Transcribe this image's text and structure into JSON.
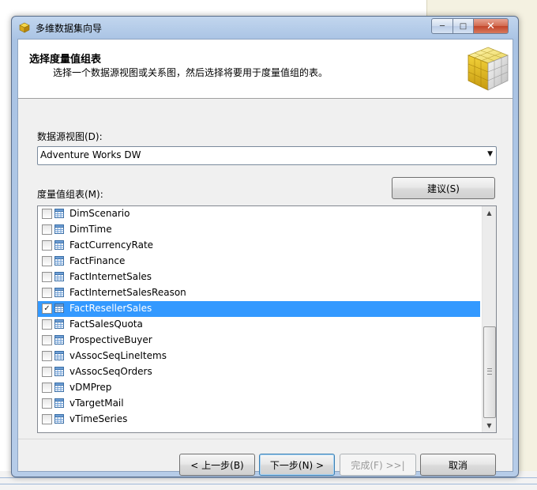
{
  "window": {
    "title": "多维数据集向导",
    "controls": {
      "minimize_icon": "minimize-icon",
      "maximize_icon": "maximize-icon",
      "close_icon": "close-icon"
    }
  },
  "header": {
    "title": "选择度量值组表",
    "subtitle": "选择一个数据源视图或关系图，然后选择将要用于度量值组的表。"
  },
  "data_source_view": {
    "label": "数据源视图(D):",
    "selected": "Adventure Works DW"
  },
  "measure_group_tables": {
    "label": "度量值组表(M):",
    "suggest_label": "建议(S)",
    "items": [
      {
        "name": "DimScenario",
        "checked": false,
        "selected": false
      },
      {
        "name": "DimTime",
        "checked": false,
        "selected": false
      },
      {
        "name": "FactCurrencyRate",
        "checked": false,
        "selected": false
      },
      {
        "name": "FactFinance",
        "checked": false,
        "selected": false
      },
      {
        "name": "FactInternetSales",
        "checked": false,
        "selected": false
      },
      {
        "name": "FactInternetSalesReason",
        "checked": false,
        "selected": false
      },
      {
        "name": "FactResellerSales",
        "checked": true,
        "selected": true
      },
      {
        "name": "FactSalesQuota",
        "checked": false,
        "selected": false
      },
      {
        "name": "ProspectiveBuyer",
        "checked": false,
        "selected": false
      },
      {
        "name": "vAssocSeqLineItems",
        "checked": false,
        "selected": false
      },
      {
        "name": "vAssocSeqOrders",
        "checked": false,
        "selected": false
      },
      {
        "name": "vDMPrep",
        "checked": false,
        "selected": false
      },
      {
        "name": "vTargetMail",
        "checked": false,
        "selected": false
      },
      {
        "name": "vTimeSeries",
        "checked": false,
        "selected": false
      }
    ]
  },
  "footer": {
    "back_label": "< 上一步(B)",
    "next_label": "下一步(N) >",
    "finish_label": "完成(F) >>|",
    "cancel_label": "取消"
  },
  "colors": {
    "selection": "#3399ff",
    "frame": "#b6cce8",
    "close_button": "#c2452a"
  }
}
